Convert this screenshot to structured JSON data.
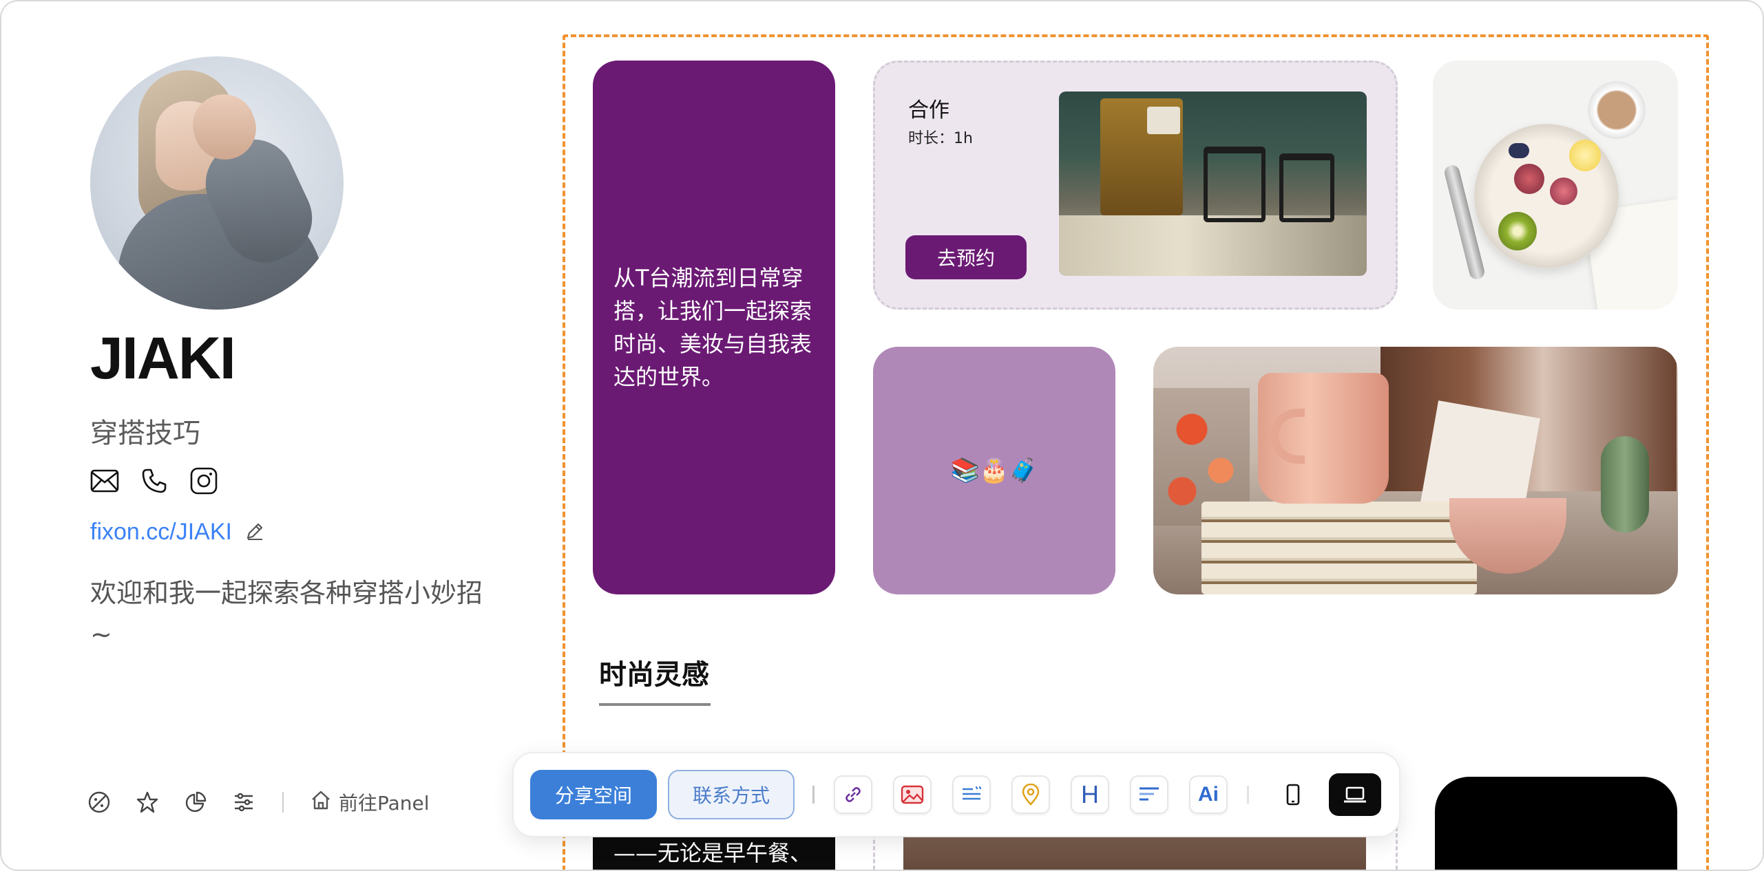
{
  "profile": {
    "name": "JIAKI",
    "tagline": "穿搭技巧",
    "link": "fixon.cc/JIAKI",
    "bio": "欢迎和我一起探索各种穿搭小妙招~",
    "contact_icons": [
      "mail-icon",
      "phone-icon",
      "instagram-icon"
    ]
  },
  "bottom_bar": {
    "icons": [
      "palette-icon",
      "star-icon",
      "pie-chart-icon",
      "sliders-icon"
    ],
    "panel_label": "前往Panel"
  },
  "cards": {
    "intro_text": "从T台潮流到日常穿搭，让我们一起探索时尚、美妆与自我表达的世界。",
    "coop_title": "合作",
    "coop_duration": "时长：1h",
    "coop_button": "去预约",
    "emojis": "📚🎂🧳"
  },
  "section": {
    "title": "时尚灵感",
    "peek_text": "——无论是早午餐、"
  },
  "toolbar": {
    "share_label": "分享空间",
    "contact_label": "联系方式",
    "tools": [
      "link-icon",
      "image-icon",
      "text-icon",
      "location-icon",
      "heading-icon",
      "section-icon",
      "ai-icon"
    ],
    "heading_glyph": "H",
    "ai_glyph": "Ai",
    "devices": [
      "mobile-icon",
      "desktop-icon"
    ],
    "active_device": "desktop"
  },
  "colors": {
    "accent_purple": "#6b1a74",
    "light_purple": "#b088b8",
    "primary_blue": "#3b7fd9",
    "dashed_orange": "#f0922e"
  }
}
